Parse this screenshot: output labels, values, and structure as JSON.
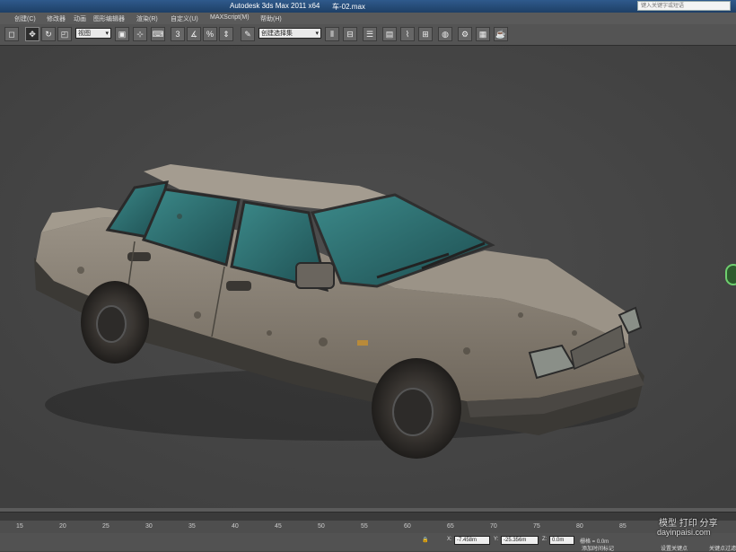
{
  "titlebar": {
    "app_title": "Autodesk 3ds Max  2011 x64",
    "file_name": "车-02.max",
    "search_placeholder": "键入关键字或短语"
  },
  "menu": [
    "创建(C)",
    "修改器",
    "动画",
    "图形编辑器",
    "渲染(R)",
    "自定义(U)",
    "MAXScript(M)",
    "帮助(H)"
  ],
  "toolbar": {
    "view_dropdown": "视图",
    "selection_set_dropdown": "创建选择集"
  },
  "timeline": {
    "ticks": [
      "15",
      "20",
      "25",
      "30",
      "35",
      "40",
      "45",
      "50",
      "55",
      "60",
      "65",
      "70",
      "75",
      "80",
      "85"
    ]
  },
  "status": {
    "x_label": "X:",
    "x_value": "-7.458m",
    "y_label": "Y:",
    "y_value": "-25.356m",
    "z_label": "Z:",
    "z_value": "0.0m",
    "grid_text": "栅格 = 0.0m",
    "add_time_tag": "添加时间标记",
    "set_key": "设置关键点",
    "auto_key": "关键点过滤"
  },
  "watermark": {
    "line1": "模型 打印 分享",
    "line2": "dayinpaisi.com"
  },
  "colors": {
    "viewport_bg": "#474747",
    "title_blue": "#1e3f66",
    "glass": "#2f6f72",
    "body_paint": "#8a8276"
  }
}
